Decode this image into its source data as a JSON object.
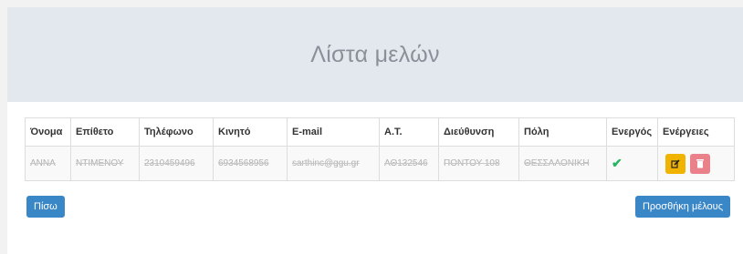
{
  "page": {
    "title": "Λίστα μελών"
  },
  "table": {
    "headers": [
      "Όνομα",
      "Επίθετο",
      "Τηλέφωνο",
      "Κινητό",
      "E-mail",
      "Α.Τ.",
      "Διεύθυνση",
      "Πόλη",
      "Ενεργός",
      "Ενέργειες"
    ],
    "rows": [
      {
        "first_name": "ΑΝΝΑ",
        "last_name": "ΝΤΙΜΕΝΟΥ",
        "phone": "2310459496",
        "mobile": "6934568956",
        "email": "sarthinc@ggu.gr",
        "id_card": "ΑΘ132546",
        "address": "ΠΟΝΤΟΥ 108",
        "city": "ΘΕΣΣΑΛΟΝΙΚΗ",
        "active_icon": "checkmark-icon",
        "active": true
      }
    ]
  },
  "buttons": {
    "back_label": "Πίσω",
    "add_label": "Προσθήκη μέλους"
  },
  "colors": {
    "primary": "#3a87c8",
    "edit": "#f0b400",
    "delete": "#e9808a",
    "active_check": "#28b463",
    "header_bg": "#e3e7ee"
  }
}
